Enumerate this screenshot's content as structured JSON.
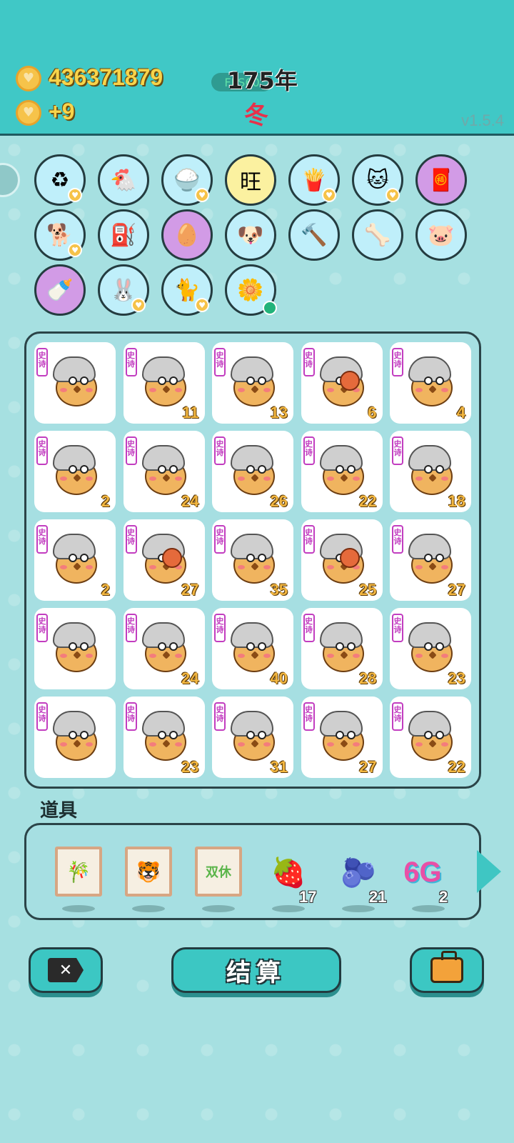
{
  "header": {
    "money": "436371879",
    "income": "+9",
    "fps_label": "FPS60",
    "year": "175年",
    "season": "冬",
    "version": "v1.5.4"
  },
  "icons": [
    {
      "name": "refresh-icon",
      "glyph": "♻",
      "style": "blue",
      "badge": true
    },
    {
      "name": "chicken-egg-icon",
      "glyph": "🐔",
      "style": "blue",
      "badge": false
    },
    {
      "name": "rice-bowl-icon",
      "glyph": "🍚",
      "style": "blue",
      "badge": true
    },
    {
      "name": "wang-tiles-icon",
      "glyph": "旺",
      "style": "yellow",
      "badge": false
    },
    {
      "name": "fries-icon",
      "glyph": "🍟",
      "style": "blue",
      "badge": true
    },
    {
      "name": "cat-icon",
      "glyph": "🐱",
      "style": "blue",
      "badge": true
    },
    {
      "name": "red-envelope-icon",
      "glyph": "🧧",
      "style": "purple",
      "badge": false
    },
    {
      "name": "husky-dog-icon",
      "glyph": "🐕",
      "style": "blue",
      "badge": true
    },
    {
      "name": "pump-icon",
      "glyph": "⛽",
      "style": "blue",
      "badge": false
    },
    {
      "name": "egg-icon",
      "glyph": "🥚",
      "style": "purple",
      "badge": false
    },
    {
      "name": "cool-dog-icon",
      "glyph": "🐶",
      "style": "blue",
      "badge": false
    },
    {
      "name": "hammer-icon",
      "glyph": "🔨",
      "style": "blue",
      "badge": false
    },
    {
      "name": "dog-bowl-icon",
      "glyph": "🦴",
      "style": "blue",
      "badge": false
    },
    {
      "name": "piggy-bank-icon",
      "glyph": "🐷",
      "style": "blue",
      "badge": false
    },
    {
      "name": "breast-pump-icon",
      "glyph": "🍼",
      "style": "purple",
      "badge": false
    },
    {
      "name": "rabbit-icon",
      "glyph": "🐰",
      "style": "blue",
      "badge": true
    },
    {
      "name": "cat-back-icon",
      "glyph": "🐈",
      "style": "blue",
      "badge": true
    },
    {
      "name": "potted-flower-icon",
      "glyph": "🌼",
      "style": "blue",
      "badge": false,
      "dot": true
    }
  ],
  "board": {
    "tag": "史诗",
    "cells": [
      {
        "num": "",
        "ball": false
      },
      {
        "num": "11",
        "ball": false
      },
      {
        "num": "13",
        "ball": false
      },
      {
        "num": "6",
        "ball": true
      },
      {
        "num": "4",
        "ball": false
      },
      {
        "num": "2",
        "ball": false
      },
      {
        "num": "24",
        "ball": false
      },
      {
        "num": "26",
        "ball": false
      },
      {
        "num": "22",
        "ball": false
      },
      {
        "num": "18",
        "ball": false
      },
      {
        "num": "2",
        "ball": false
      },
      {
        "num": "27",
        "ball": true
      },
      {
        "num": "35",
        "ball": false
      },
      {
        "num": "25",
        "ball": true
      },
      {
        "num": "27",
        "ball": false
      },
      {
        "num": "",
        "ball": false
      },
      {
        "num": "24",
        "ball": false
      },
      {
        "num": "40",
        "ball": false
      },
      {
        "num": "28",
        "ball": false
      },
      {
        "num": "23",
        "ball": false
      },
      {
        "num": "",
        "ball": false
      },
      {
        "num": "23",
        "ball": false
      },
      {
        "num": "31",
        "ball": false
      },
      {
        "num": "27",
        "ball": false
      },
      {
        "num": "22",
        "ball": false
      }
    ]
  },
  "items": {
    "label": "道具",
    "list": [
      {
        "name": "bamboo-frame-item",
        "glyph": "🎋",
        "frame": true,
        "count": ""
      },
      {
        "name": "tiger-frame-item",
        "glyph": "🐯",
        "frame": true,
        "count": ""
      },
      {
        "name": "double-rest-frame-item",
        "glyph": "双休",
        "frame": true,
        "count": ""
      },
      {
        "name": "strawberry-item",
        "glyph": "🍓",
        "frame": false,
        "count": "17"
      },
      {
        "name": "bayberry-item",
        "glyph": "🫐",
        "frame": false,
        "count": "21"
      },
      {
        "name": "6g-item",
        "glyph": "6G",
        "frame": false,
        "count": "2"
      }
    ]
  },
  "buttons": {
    "settle": "结算"
  }
}
